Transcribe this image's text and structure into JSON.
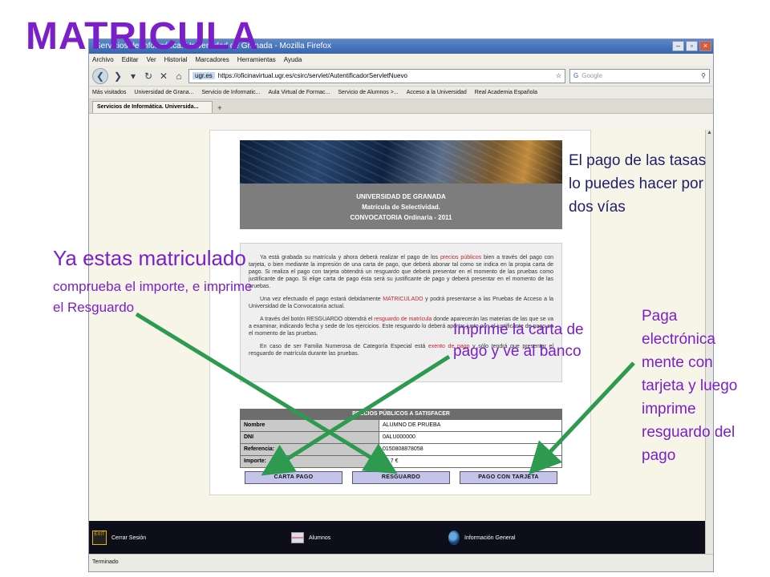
{
  "slide": {
    "title": "MATRICULA",
    "annotations": {
      "two_ways": "El pago de las tasas lo puedes hacer por dos vías",
      "enrolled_title": "Ya estas matriculado",
      "enrolled_detail": "comprueba el importe, e imprime el Resguardo",
      "print_letter": "Imprime la carta de pago y ve al banco",
      "pay_card": "Paga electrónica mente con tarjeta y luego imprime resguardo del pago"
    }
  },
  "browser": {
    "window_title": "Servicios de Informática. Universidad de Granada - Mozilla Firefox",
    "menu": [
      "Archivo",
      "Editar",
      "Ver",
      "Historial",
      "Marcadores",
      "Herramientas",
      "Ayuda"
    ],
    "url_host": "ugr.es",
    "url": "https://oficinavirtual.ugr.es/csirc/servlet/AutentificadorServletNuevo",
    "search_placeholder": "Google",
    "bookmarks": [
      "Más visitados",
      "Universidad de Grana...",
      "Servicio de Informatic...",
      "Aula Virtual de Formac...",
      "Servicio de Alumnos >...",
      "Acceso a la Universidad",
      "Real Academia Española"
    ],
    "tab_label": "Servicios de Informática. Universida...",
    "status": "Terminado"
  },
  "page": {
    "header_lines": [
      "UNIVERSIDAD DE GRANADA",
      "Matrícula de Selectividad.",
      "CONVOCATORIA Ordinaria - 2011"
    ],
    "info_p1_a": "Ya está grabada su matrícula y ahora deberá realizar el pago de los ",
    "info_p1_link": "precios públicos",
    "info_p1_b": " bien a través del pago con tarjeta, o bien mediante la impresión de una carta de pago, que deberá abonar tal como se indica en la propia carta de pago. Si realiza el pago con tarjeta obtendrá un resguardo que deberá presentar en el momento de las pruebas como justificante de pago. Si elige carta de pago ésta será su justificante de pago y deberá presentar en el momento de las pruebas.",
    "info_p2_a": "Una vez efectuado el pago estará debidamente ",
    "info_p2_link": "MATRICULADO",
    "info_p2_b": " y podrá presentarse a las Pruebas de Acceso a la Universidad de la Convocatoria actual.",
    "info_p3_a": "A través del botón RESGUARDO obtendrá el ",
    "info_p3_link": "resguardo de matrícula",
    "info_p3_b": " donde aparecerán las materias de las que se va a examinar, indicando fecha y sede de los ejercicios. Este resguardo lo deberá aportar junto con el justificante de pago en el momento de las pruebas.",
    "info_p4_a": "En caso de ser Familia Numerosa de Categoría Especial está ",
    "info_p4_link": "exento de pago",
    "info_p4_b": " y sólo tendrá que presentar el resguardo de matrícula durante las pruebas.",
    "prices_title": "PRECIOS PÚBLICOS A SATISFACER",
    "prices_rows": [
      {
        "label": "Nombre",
        "value": "ALUMNO DE PRUEBA"
      },
      {
        "label": "DNI",
        "value": "0ALU000000"
      },
      {
        "label": "Referencia:",
        "value": "0150808878058"
      },
      {
        "label": "Importe:",
        "value": "54.7 €"
      }
    ],
    "buttons": {
      "carta_pago": "CARTA PAGO",
      "resguardo": "RESGUARDO",
      "pago_tarjeta": "PAGO CON TARJETA"
    },
    "footer": {
      "logout": "Cerrar Sesión",
      "logout_badge": "EXIT",
      "students": "Alumnos",
      "general_info": "Información General"
    }
  },
  "colors": {
    "annotation_purple": "#7a1fc9",
    "annotation_navy": "#1f1f6e",
    "arrow_green": "#2e9a50",
    "button_fill": "#c4c4ea"
  }
}
